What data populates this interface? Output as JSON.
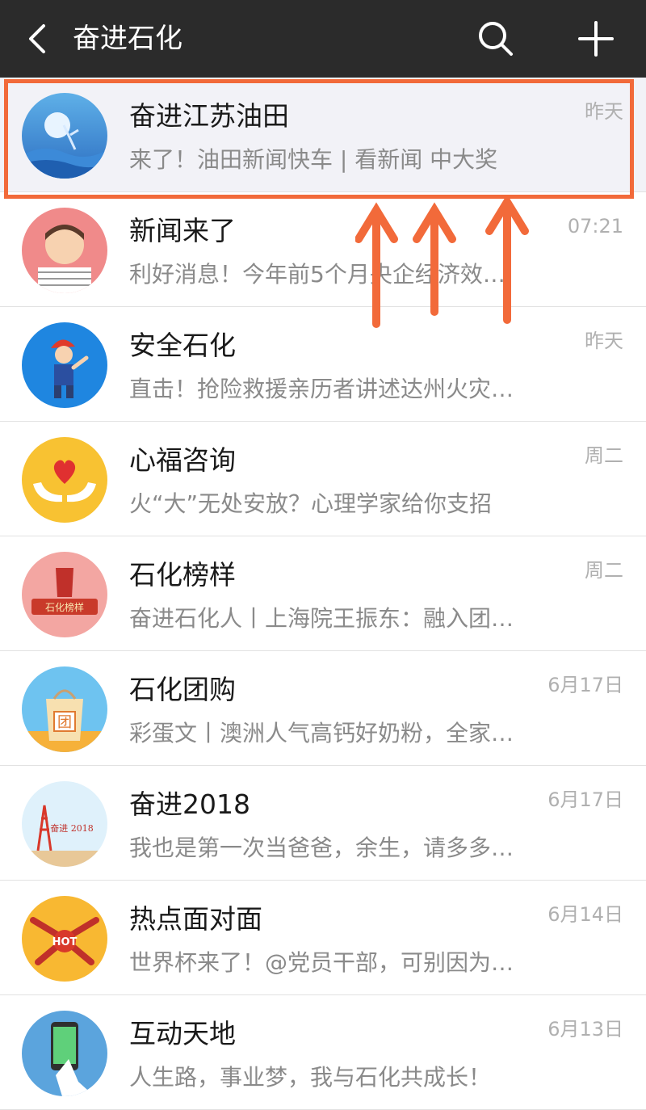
{
  "header": {
    "title": "奋进石化",
    "back_icon": "chevron-left-icon",
    "search_icon": "search-icon",
    "add_icon": "plus-icon"
  },
  "accent_color": "#f26a3a",
  "items": [
    {
      "name": "奋进江苏油田",
      "preview": "来了！油田新闻快车 | 看新闻 中大奖",
      "time": "昨天"
    },
    {
      "name": "新闻来了",
      "preview": "利好消息！今年前5个月央企经济效…",
      "time": "07:21"
    },
    {
      "name": "安全石化",
      "preview": "直击！抢险救援亲历者讲述达州火灾…",
      "time": "昨天"
    },
    {
      "name": "心福咨询",
      "preview": "火“大”无处安放？心理学家给你支招",
      "time": "周二"
    },
    {
      "name": "石化榜样",
      "preview": "奋进石化人丨上海院王振东：融入团…",
      "time": "周二"
    },
    {
      "name": "石化团购",
      "preview": "彩蛋文丨澳洲人气高钙好奶粉，全家…",
      "time": "6月17日"
    },
    {
      "name": "奋进2018",
      "preview": "我也是第一次当爸爸，余生，请多多…",
      "time": "6月17日"
    },
    {
      "name": "热点面对面",
      "preview": "世界杯来了！@党员干部，可别因为…",
      "time": "6月14日"
    },
    {
      "name": "互动天地",
      "preview": "人生路，事业梦，我与石化共成长！",
      "time": "6月13日"
    }
  ],
  "avatars": {
    "a1_text": "",
    "a5_text": "石化榜样",
    "a6_text": "团",
    "a7_text": "奋进 2018",
    "a8_text": "HOT"
  }
}
